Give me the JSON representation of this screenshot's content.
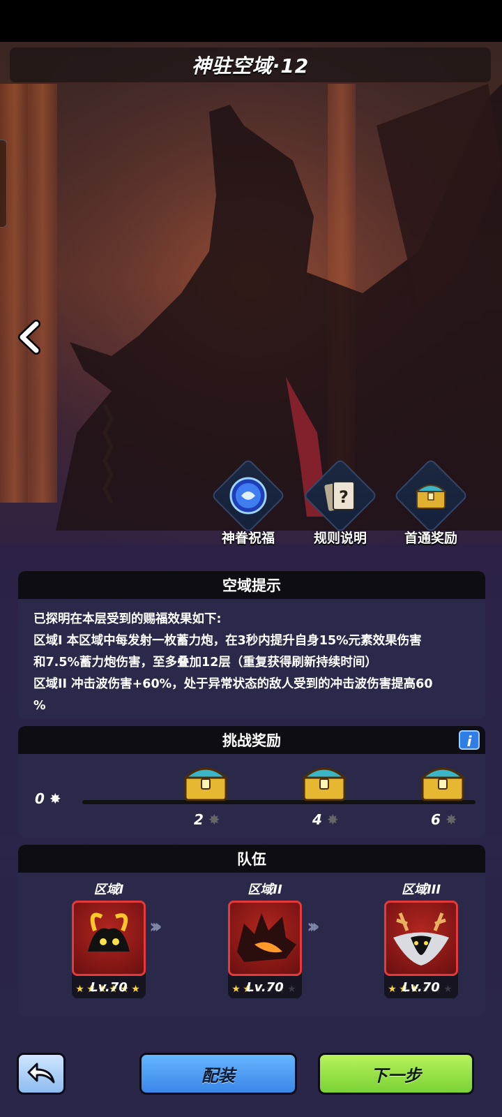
{
  "header": {
    "title": "神驻空域·12"
  },
  "actions": [
    {
      "label": "神眷祝福",
      "icon": "blessing-orb-icon"
    },
    {
      "label": "规则说明",
      "icon": "rules-scroll-icon"
    },
    {
      "label": "首通奖励",
      "icon": "treasure-chest-icon"
    }
  ],
  "hint": {
    "title": "空域提示",
    "lines": [
      "已探明在本层受到的赐福效果如下:",
      "区域I 本区域中每发射一枚蓄力炮，在3秒内提升自身15%元素效果伤害",
      "和7.5%蓄力炮伤害，至多叠加12层（重复获得刷新持续时间）",
      "区域II 冲击波伤害+60%，处于异常状态的敌人受到的冲击波伤害提高60",
      "%"
    ]
  },
  "reward": {
    "title": "挑战奖励",
    "info_label": "i",
    "current": "0",
    "progress": 0,
    "milestones": [
      "2",
      "4",
      "6"
    ]
  },
  "team": {
    "title": "队伍",
    "members": [
      {
        "zone": "区域I",
        "level": "Lv.70",
        "stars": 6,
        "max_stars": 6
      },
      {
        "zone": "区域II",
        "level": "Lv.70",
        "stars": 2,
        "max_stars": 6
      },
      {
        "zone": "区域III",
        "level": "Lv.70",
        "stars": 3,
        "max_stars": 6
      }
    ]
  },
  "buttons": {
    "equip": "配装",
    "next": "下一步"
  },
  "colors": {
    "equip": "#4a9bf5",
    "next": "#94e046",
    "accent_red": "#e33b3b"
  }
}
